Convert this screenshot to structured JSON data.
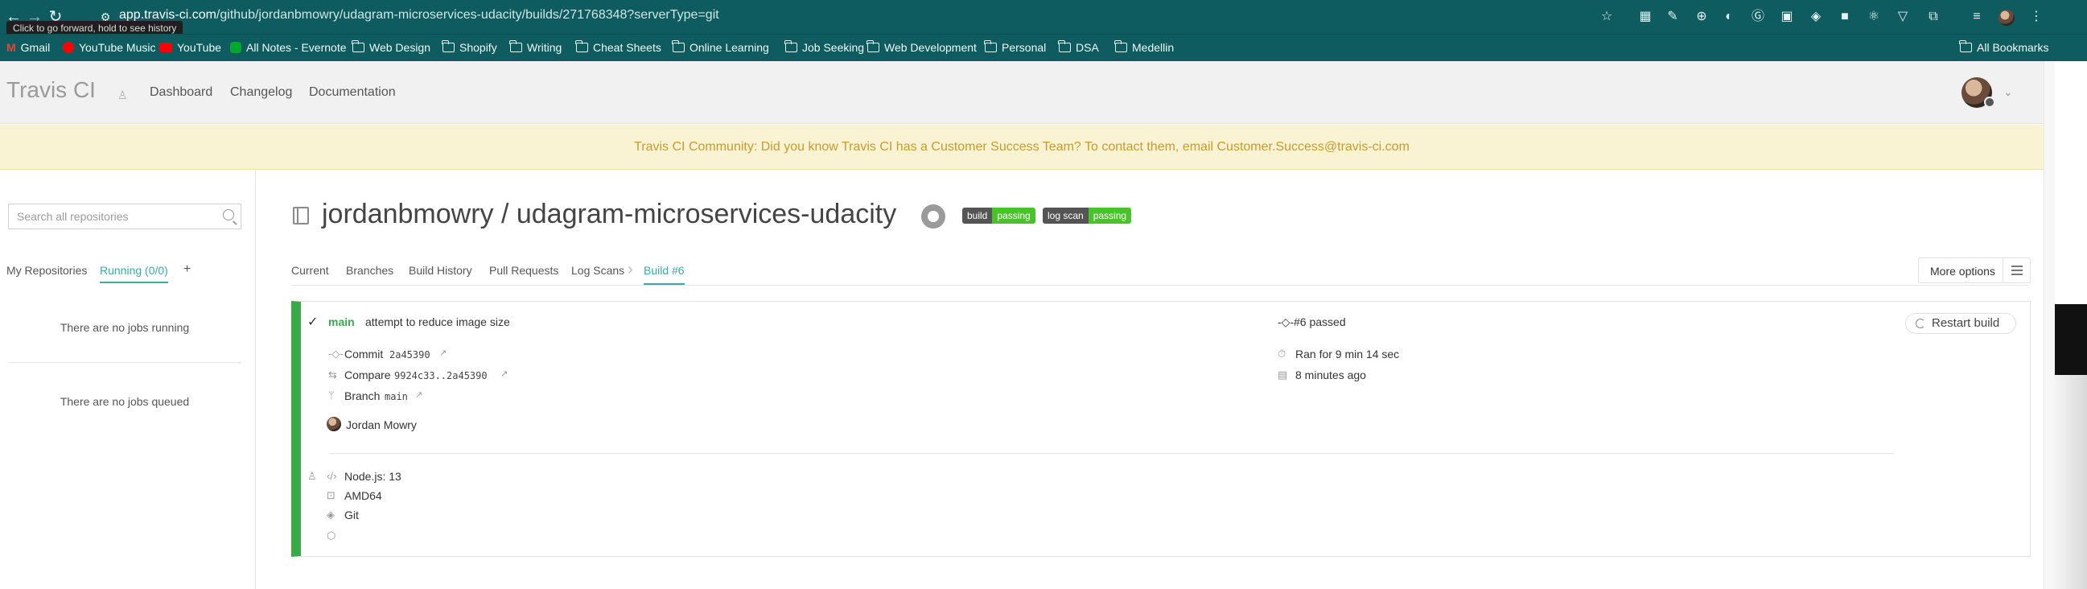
{
  "browser": {
    "url_host": "app.travis-ci.com",
    "url_path": "/github/jordanbmowry/udagram-microservices-udacity/builds/271768348?serverType=git",
    "tooltip": "Click to go forward, hold to see history",
    "bookmarks": [
      {
        "label": "Gmail",
        "icon": "gmail-icon"
      },
      {
        "label": "YouTube Music",
        "icon": "youtube-music-icon"
      },
      {
        "label": "YouTube",
        "icon": "youtube-icon"
      },
      {
        "label": "All Notes - Evernote",
        "icon": "evernote-icon"
      },
      {
        "label": "Web Design",
        "icon": "folder-icon"
      },
      {
        "label": "Shopify",
        "icon": "folder-icon"
      },
      {
        "label": "Writing",
        "icon": "folder-icon"
      },
      {
        "label": "Cheat Sheets",
        "icon": "folder-icon"
      },
      {
        "label": "Online Learning",
        "icon": "folder-icon"
      },
      {
        "label": "Job Seeking",
        "icon": "folder-icon"
      },
      {
        "label": "Web Development",
        "icon": "folder-icon"
      },
      {
        "label": "Personal",
        "icon": "folder-icon"
      },
      {
        "label": "DSA",
        "icon": "folder-icon"
      },
      {
        "label": "Medellin",
        "icon": "folder-icon"
      }
    ],
    "all_bookmarks": "All Bookmarks"
  },
  "header": {
    "logo": "Travis CI",
    "nav": [
      "Dashboard",
      "Changelog",
      "Documentation"
    ]
  },
  "banner": "Travis CI Community: Did you know Travis CI has a Customer Success Team? To contact them, email Customer.Success@travis-ci.com",
  "sidebar": {
    "search_placeholder": "Search all repositories",
    "tabs": [
      "My Repositories",
      "Running (0/0)",
      "+"
    ],
    "no_running": "There are no jobs running",
    "no_queued": "There are no jobs queued"
  },
  "repo": {
    "title": "jordanbmowry / udagram-microservices-udacity",
    "badges": [
      {
        "left": "build",
        "right": "passing"
      },
      {
        "left": "log scan",
        "right": "passing"
      }
    ],
    "tabs": [
      "Current",
      "Branches",
      "Build History",
      "Pull Requests",
      "Log Scans"
    ],
    "active_tab": "Build #6",
    "more_options": "More options"
  },
  "build": {
    "branch": "main",
    "message": "attempt to reduce image size",
    "status": "#6 passed",
    "restart": "Restart build",
    "commit_label": "Commit",
    "commit_hash": "2a45390",
    "compare_label": "Compare",
    "compare_range": "9924c33..2a45390",
    "branch_label": "Branch",
    "branch_name": "main",
    "author": "Jordan Mowry",
    "duration": "Ran for 9 min 14 sec",
    "time_ago": "8 minutes ago",
    "env_language": "Node.js: 13",
    "env_arch": "AMD64",
    "env_vcs": "Git"
  },
  "colors": {
    "chrome": "#0e5c5f",
    "accent": "#39aaa4",
    "passed": "#39a94a",
    "banner_bg": "#faf3d3",
    "banner_text": "#c79b2c"
  }
}
